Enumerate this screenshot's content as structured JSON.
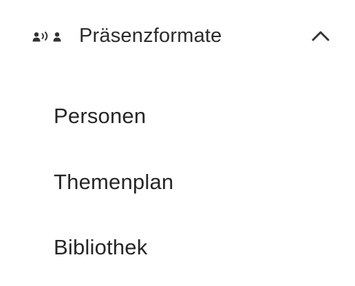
{
  "section": {
    "title": "Präsenzformate",
    "icon": "presenter-audience-icon",
    "state": "expanded",
    "chevron_icon": "chevron-up-icon"
  },
  "items": [
    {
      "label": "Personen"
    },
    {
      "label": "Themenplan"
    },
    {
      "label": "Bibliothek"
    }
  ],
  "colors": {
    "text": "#262626",
    "icon": "#333333"
  }
}
